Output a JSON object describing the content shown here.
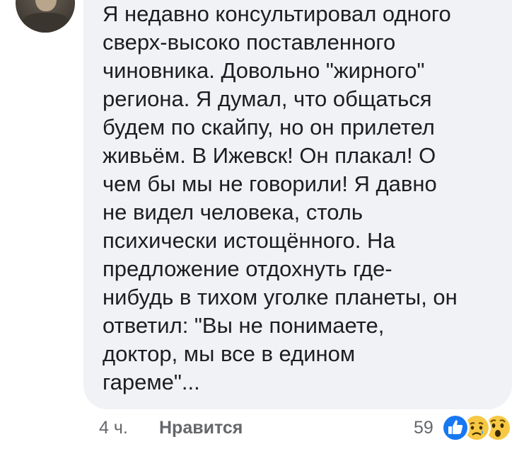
{
  "comment": {
    "lines": [
      "Я недавно консультировал одного",
      "сверх-высоко поставленного",
      "чиновника. Довольно \"жирного\"",
      "региона. Я думал, что общаться",
      "будем по скайпу, но он прилетел",
      "живьём. В Ижевск! Он плакал! О",
      "чем бы мы не говорили! Я давно",
      "не видел человека, столь",
      "психически истощённого. На",
      "предложение отдохнуть где-",
      "нибудь в тихом уголке планеты, он",
      "ответил: \"Вы не понимаете,",
      "доктор, мы все в едином",
      "гареме\"..."
    ]
  },
  "footer": {
    "time": "4 ч.",
    "like_label": "Нравится",
    "reaction_count": "59"
  },
  "reactions": {
    "icons": [
      "like-icon",
      "sad-icon",
      "wow-icon"
    ]
  },
  "colors": {
    "bubble_bg": "#f0f2f5",
    "text": "#1c1e21",
    "meta": "#65676b",
    "like_blue": "#1877f2",
    "emoji_yellow": "#f7c844"
  }
}
